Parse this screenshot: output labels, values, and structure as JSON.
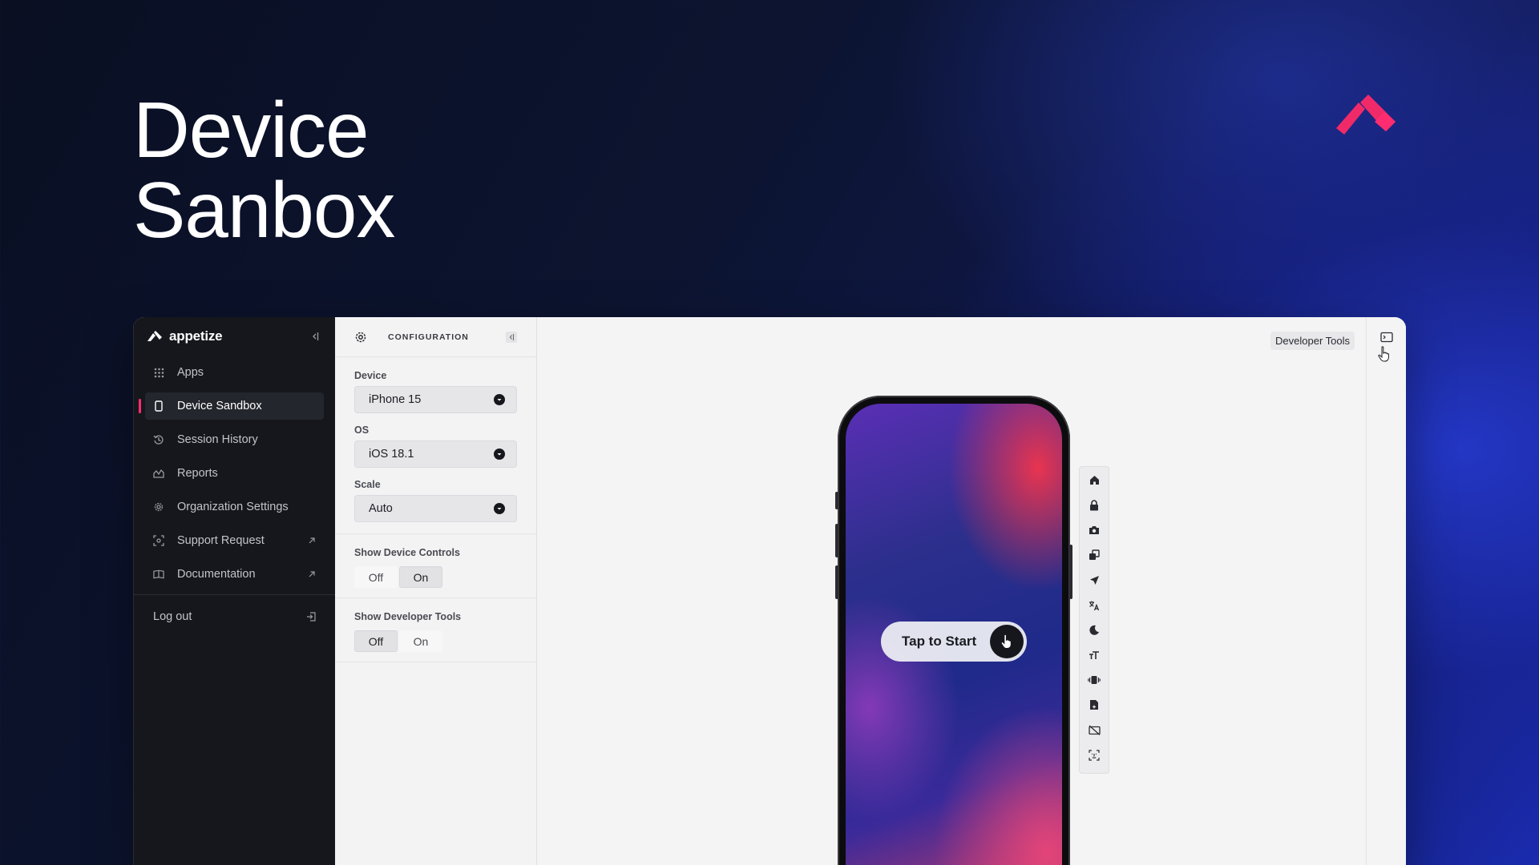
{
  "hero": {
    "line1": "Device",
    "line2": "Sanbox"
  },
  "colors": {
    "accent": "#ff2d6f",
    "sidebar_bg": "#16171c",
    "logo": "#f02a68"
  },
  "sidebar": {
    "brand": "appetize",
    "items": [
      {
        "label": "Apps",
        "icon": "grid-icon"
      },
      {
        "label": "Device Sandbox",
        "icon": "phone-icon",
        "active": true
      },
      {
        "label": "Session History",
        "icon": "history-icon"
      },
      {
        "label": "Reports",
        "icon": "chart-icon"
      },
      {
        "label": "Organization Settings",
        "icon": "gear-icon"
      },
      {
        "label": "Support Request",
        "icon": "support-icon",
        "external": true
      },
      {
        "label": "Documentation",
        "icon": "book-icon",
        "external": true
      }
    ],
    "logout": "Log out"
  },
  "config": {
    "title": "CONFIGURATION",
    "device": {
      "label": "Device",
      "value": "iPhone 15"
    },
    "os": {
      "label": "OS",
      "value": "iOS 18.1"
    },
    "scale": {
      "label": "Scale",
      "value": "Auto"
    },
    "show_device_controls": {
      "label": "Show Device Controls",
      "off": "Off",
      "on": "On",
      "selected": "On"
    },
    "show_developer_tools": {
      "label": "Show Developer Tools",
      "off": "Off",
      "on": "On",
      "selected": "Off"
    }
  },
  "stage": {
    "developer_tools": "Developer Tools",
    "tap_to_start": "Tap to Start",
    "controls": [
      "home-icon",
      "lock-icon",
      "camera-icon",
      "screenshot-icon",
      "location-icon",
      "translate-icon",
      "dark-mode-icon",
      "text-size-icon",
      "shake-icon",
      "file-icon",
      "camera-off-icon",
      "face-id-icon"
    ]
  }
}
